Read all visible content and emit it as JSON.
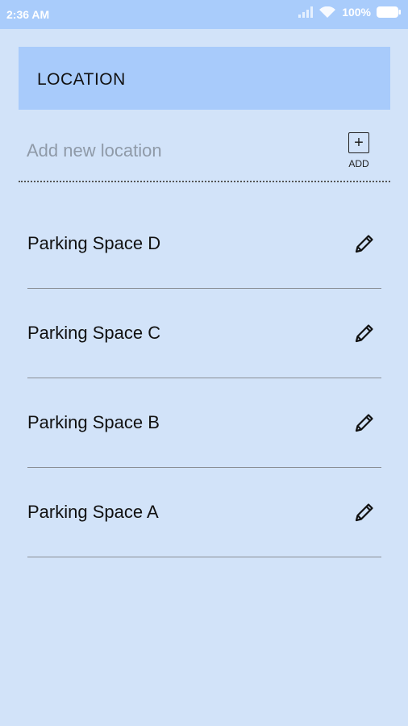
{
  "status_bar": {
    "time": "2:36 AM",
    "battery": "100%"
  },
  "header": {
    "title": "LOCATION"
  },
  "add_location": {
    "placeholder": "Add new location",
    "value": "",
    "button_symbol": "+",
    "button_label": "ADD"
  },
  "locations": [
    {
      "label": "Parking Space D",
      "icon": "pencil-icon"
    },
    {
      "label": "Parking Space C",
      "icon": "pencil-icon"
    },
    {
      "label": "Parking Space B",
      "icon": "pencil-icon"
    },
    {
      "label": "Parking Space A",
      "icon": "pencil-icon"
    }
  ],
  "colors": {
    "background": "#d2e3f9",
    "header_background": "#a8cbfb",
    "status_bar_background": "#a9ccfb"
  }
}
